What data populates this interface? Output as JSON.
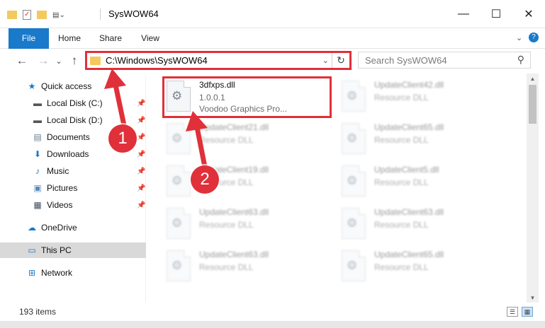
{
  "window": {
    "title": "SysWOW64",
    "minimize": "—",
    "maximize": "☐",
    "close": "✕"
  },
  "ribbon": {
    "tabs": [
      "File",
      "Home",
      "Share",
      "View"
    ],
    "expand": "⌄",
    "help": "?"
  },
  "nav": {
    "back": "←",
    "forward": "→",
    "recent": "⌄",
    "up": "↑",
    "address": "C:\\Windows\\SysWOW64",
    "address_dropdown": "⌄",
    "refresh": "↻",
    "search_placeholder": "Search SysWOW64",
    "search_icon": "⚲"
  },
  "sidebar": {
    "items": [
      {
        "label": "Quick access",
        "icon": "★"
      },
      {
        "label": "Local Disk (C:)",
        "icon": "▬",
        "pin": "📌"
      },
      {
        "label": "Local Disk (D:)",
        "icon": "▬",
        "pin": "📌"
      },
      {
        "label": "Documents",
        "icon": "▤",
        "pin": "📌"
      },
      {
        "label": "Downloads",
        "icon": "⬇",
        "pin": "📌"
      },
      {
        "label": "Music",
        "icon": "♪",
        "pin": "📌"
      },
      {
        "label": "Pictures",
        "icon": "▣",
        "pin": "📌"
      },
      {
        "label": "Videos",
        "icon": "▦",
        "pin": "📌"
      },
      {
        "label": "OneDrive",
        "icon": "☁"
      },
      {
        "label": "This PC",
        "icon": "▭"
      },
      {
        "label": "Network",
        "icon": "⊞"
      }
    ]
  },
  "files": [
    {
      "name": "3dfxps.dll",
      "line2": "1.0.0.1",
      "line3": "Voodoo Graphics Pro..."
    },
    {
      "name": "UpdateClient42.dll",
      "line2": "Resource DLL"
    },
    {
      "name": "UpdateClient21.dll",
      "line2": "Resource DLL"
    },
    {
      "name": "UpdateClient65.dll",
      "line2": "Resource DLL"
    },
    {
      "name": "UpdateClient19.dll",
      "line2": "Resource DLL"
    },
    {
      "name": "UpdateClient5.dll",
      "line2": "Resource DLL"
    },
    {
      "name": "UpdateClient63.dll",
      "line2": "Resource DLL"
    },
    {
      "name": "UpdateClient63.dll",
      "line2": "Resource DLL"
    },
    {
      "name": "UpdateClient63.dll",
      "line2": "Resource DLL"
    },
    {
      "name": "UpdateClient65.dll",
      "line2": "Resource DLL"
    }
  ],
  "status": {
    "item_count": "193 items"
  },
  "callouts": {
    "one": "1",
    "two": "2"
  },
  "colors": {
    "accent": "#1979ca",
    "highlight": "#e0303a",
    "folder": "#f4c95d"
  }
}
